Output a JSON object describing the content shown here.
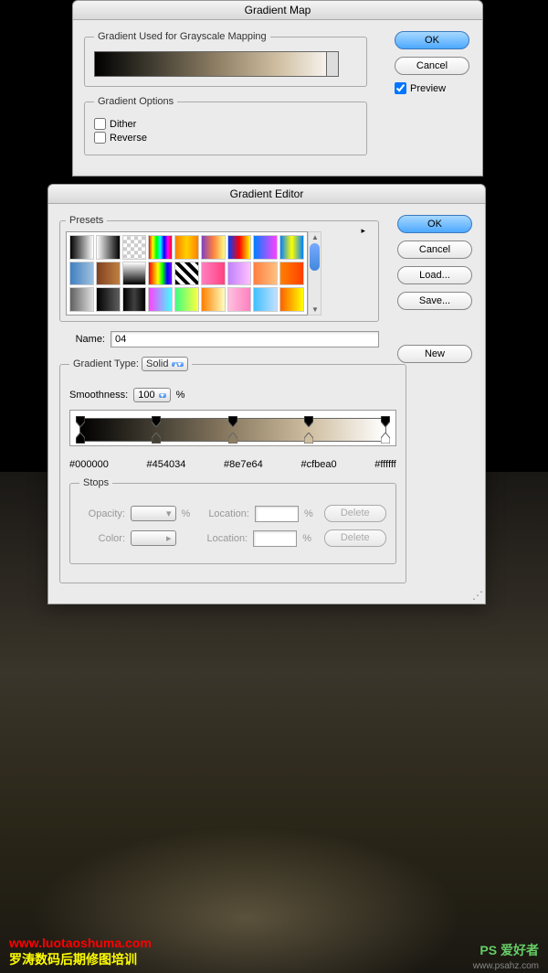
{
  "gradMap": {
    "title": "Gradient Map",
    "fieldsetLabel": "Gradient Used for Grayscale Mapping",
    "optionsLabel": "Gradient Options",
    "dither": "Dither",
    "reverse": "Reverse",
    "ok": "OK",
    "cancel": "Cancel",
    "preview": "Preview"
  },
  "gradEditor": {
    "title": "Gradient Editor",
    "presetsLabel": "Presets",
    "ok": "OK",
    "cancel": "Cancel",
    "load": "Load...",
    "save": "Save...",
    "nameLabel": "Name:",
    "nameValue": "04",
    "newBtn": "New",
    "typeLabel": "Gradient Type:",
    "typeValue": "Solid",
    "smoothLabel": "Smoothness:",
    "smoothValue": "100",
    "percent": "%",
    "stops": [
      "#000000",
      "#454034",
      "#8e7e64",
      "#cfbea0",
      "#ffffff"
    ],
    "stopsLabel": "Stops",
    "opacityLabel": "Opacity:",
    "colorLabel": "Color:",
    "locationLabel": "Location:",
    "delete": "Delete"
  },
  "presetColors": [
    "linear-gradient(to right,#000,#fff)",
    "linear-gradient(to right,#fff,#000)",
    "repeating-conic-gradient(#ccc 0 25%,#fff 0 50%) 0/8px 8px",
    "linear-gradient(to right,#f00,#ff0,#0f0,#0ff,#00f,#f0f,#f00)",
    "linear-gradient(to right,#ff8000,#ffd000,#ff8000)",
    "linear-gradient(to right,#8040c0,#ff8040,#ffff80)",
    "linear-gradient(to right,#0040ff,#ff0000,#ffff00)",
    "linear-gradient(to right,#0080ff,#ff40ff)",
    "linear-gradient(to right,#0080ff,#ffff00,#0080ff)",
    "linear-gradient(to right,#4080c0,#a0c0e0)",
    "linear-gradient(to right,#804020,#c08040)",
    "linear-gradient(#fff,#000)",
    "linear-gradient(to right,#f00,#ff8000,#ff0,#0f0,#00f,#8000ff)",
    "repeating-linear-gradient(45deg,#000 0 4px,#fff 4px 8px)",
    "linear-gradient(to right,#ff80c0,#ff4080)",
    "linear-gradient(to right,#c080ff,#ffc0ff)",
    "linear-gradient(to right,#ff8040,#ffc080)",
    "linear-gradient(to right,#ff8000,#ff4000)",
    "linear-gradient(to right,#606060,#e0e0e0)",
    "linear-gradient(to right,#000,#606060)",
    "linear-gradient(to right,#000,#404040,#000)",
    "linear-gradient(to right,#ff40ff,#40ffff)",
    "linear-gradient(to right,#40ff80,#ffff40)",
    "linear-gradient(to right,#ff8000,#ffffc0)",
    "linear-gradient(to right,#ffc0e0,#ff80c0)",
    "linear-gradient(to right,#40c0ff,#c0e0ff)",
    "linear-gradient(to right,#ff6000,#ffff00)"
  ],
  "watermarks": {
    "w1": "www.luotaoshuma.com",
    "w2": "罗涛数码后期修图培训",
    "w3": "PS 爱好者",
    "w4": "www.psahz.com"
  }
}
